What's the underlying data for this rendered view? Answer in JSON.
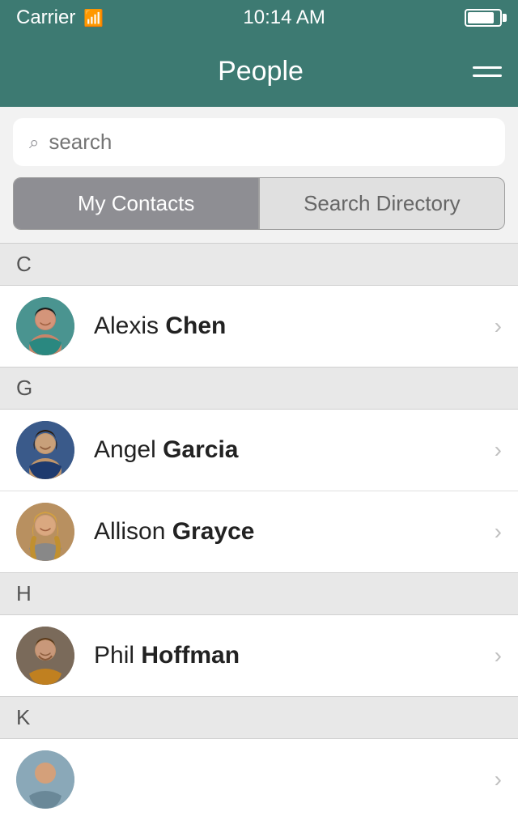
{
  "statusBar": {
    "carrier": "Carrier",
    "time": "10:14 AM",
    "wifi": "wifi"
  },
  "navBar": {
    "title": "People",
    "menuIcon": "hamburger-icon"
  },
  "search": {
    "placeholder": "search"
  },
  "tabs": [
    {
      "id": "my-contacts",
      "label": "My Contacts",
      "active": true
    },
    {
      "id": "search-directory",
      "label": "Search Directory",
      "active": false
    }
  ],
  "sections": [
    {
      "letter": "C",
      "contacts": [
        {
          "id": "alexis-chen",
          "firstName": "Alexis",
          "lastName": "Chen",
          "avatarClass": "avatar-alexis"
        }
      ]
    },
    {
      "letter": "G",
      "contacts": [
        {
          "id": "angel-garcia",
          "firstName": "Angel",
          "lastName": "Garcia",
          "avatarClass": "avatar-angel"
        },
        {
          "id": "allison-grayce",
          "firstName": "Allison",
          "lastName": "Grayce",
          "avatarClass": "avatar-allison"
        }
      ]
    },
    {
      "letter": "H",
      "contacts": [
        {
          "id": "phil-hoffman",
          "firstName": "Phil",
          "lastName": "Hoffman",
          "avatarClass": "avatar-phil"
        }
      ]
    },
    {
      "letter": "K",
      "contacts": [
        {
          "id": "k-unknown",
          "firstName": "",
          "lastName": "",
          "avatarClass": "avatar-k"
        }
      ]
    }
  ],
  "colors": {
    "teal": "#3d7a72",
    "tabActive": "#8e8e93",
    "sectionBg": "#e8e8e8"
  }
}
